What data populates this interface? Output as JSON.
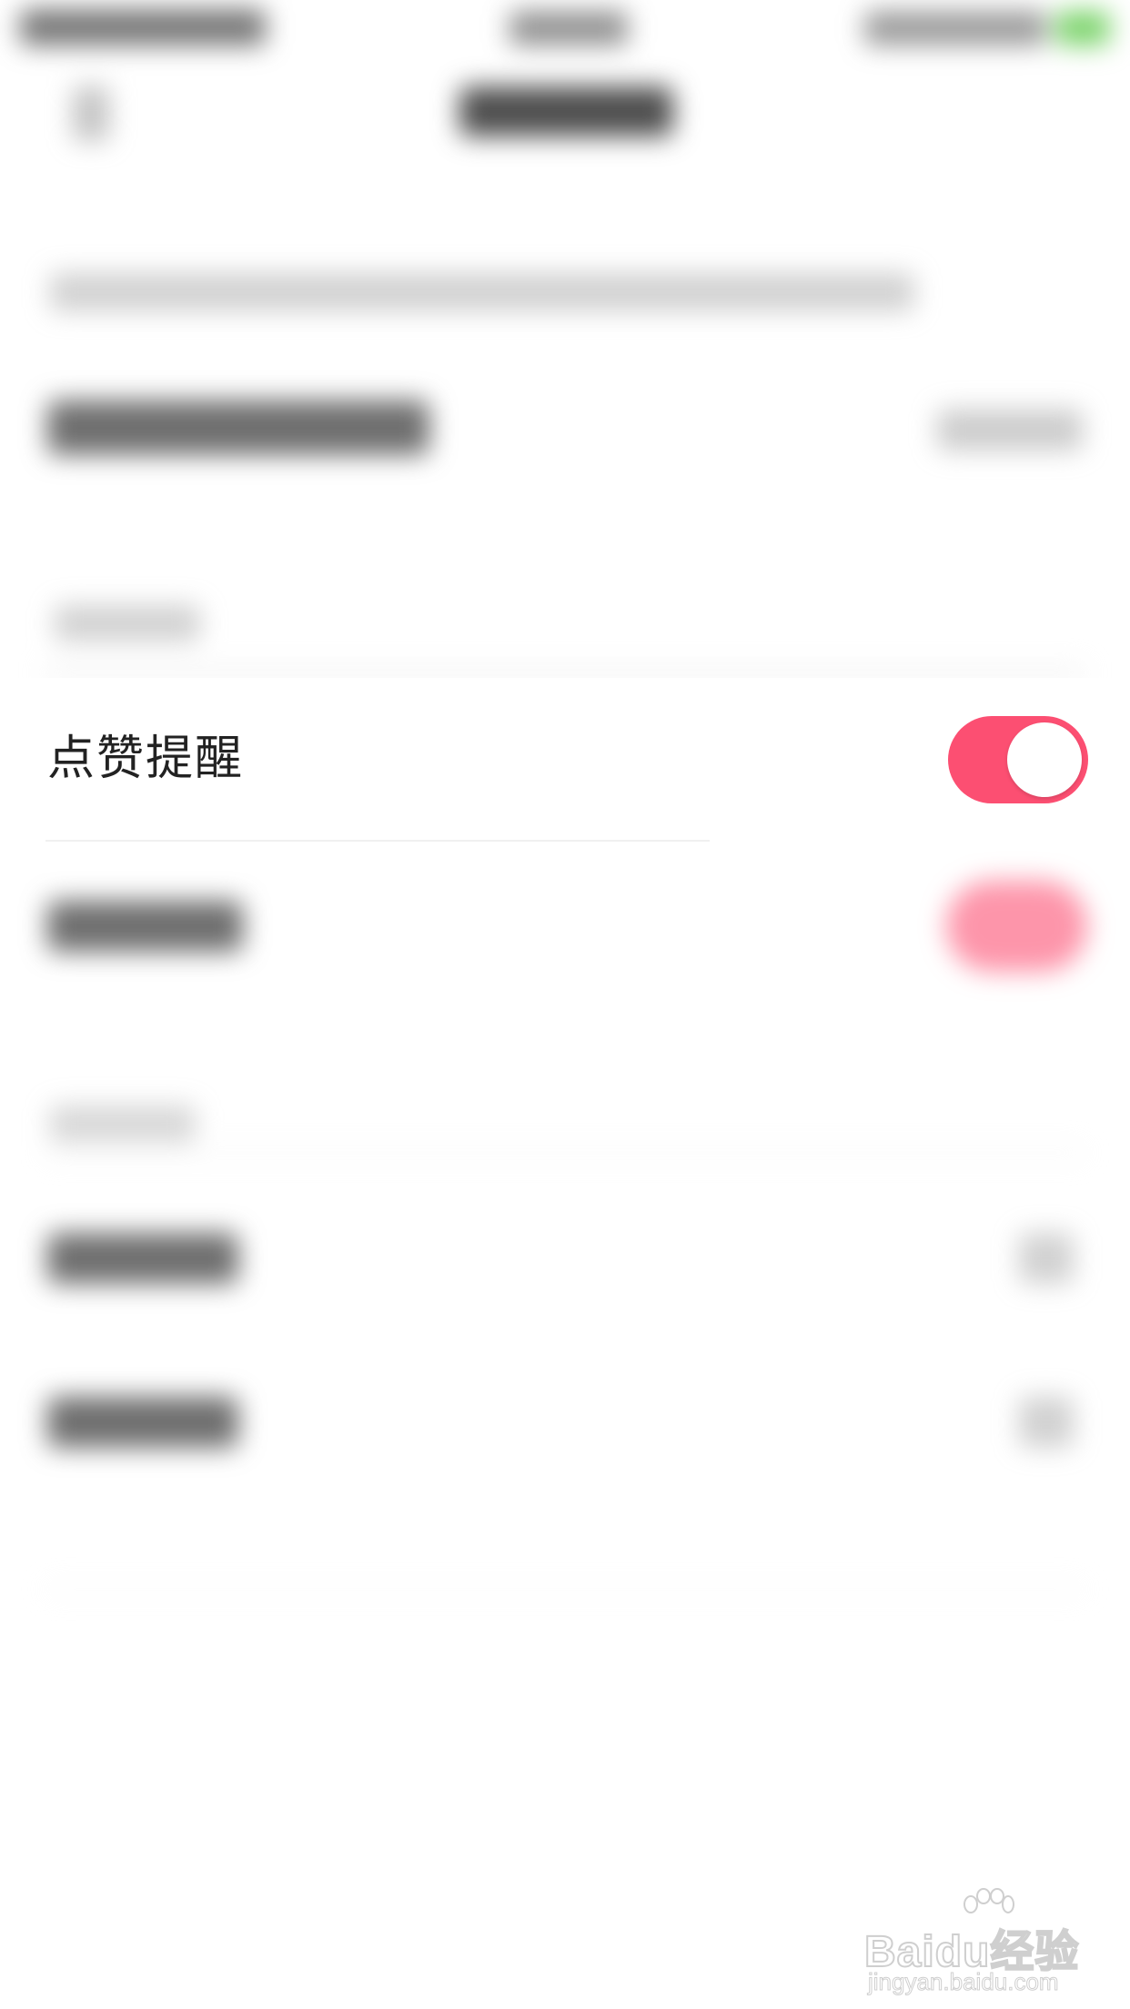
{
  "setting": {
    "label": "点赞提醒",
    "enabled": true
  },
  "colors": {
    "toggle_on": "#fc4f72",
    "knob": "#ffffff",
    "label_text": "#222222",
    "battery": "#6fcf5d"
  },
  "icons": {
    "watermark_logo": "baidu-paw-icon"
  },
  "watermark": {
    "brand": "Baidu经验",
    "url": "jingyan.baidu.com"
  }
}
